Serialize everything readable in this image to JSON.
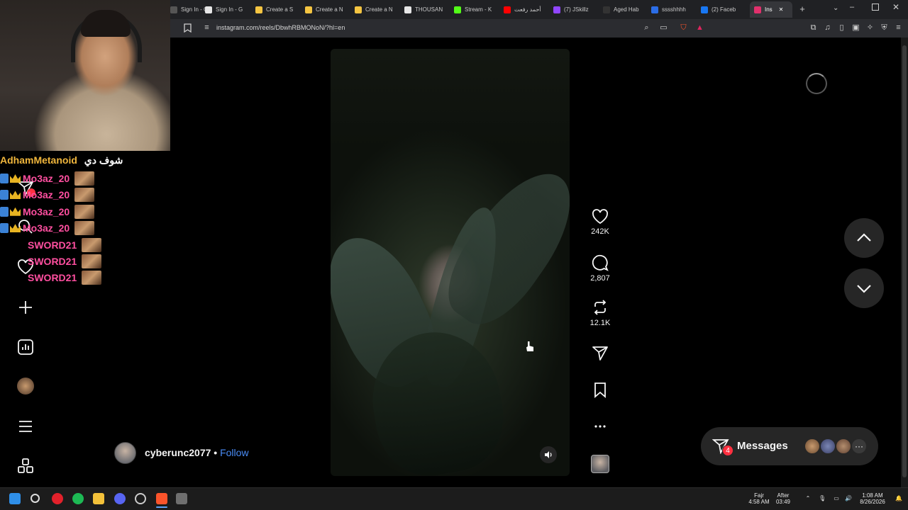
{
  "browser": {
    "tabs": [
      {
        "label": "Sign In - G",
        "color": "#555555"
      },
      {
        "label": "Sign In - G",
        "color": "#e6e6e6"
      },
      {
        "label": "Create a S",
        "color": "#f5c542"
      },
      {
        "label": "Create a N",
        "color": "#f5c542"
      },
      {
        "label": "Create a N",
        "color": "#f5c542"
      },
      {
        "label": "THOUSAN",
        "color": "#e6e6e6"
      },
      {
        "label": "Stream - K",
        "color": "#53fc18"
      },
      {
        "label": "أحمد رفعت",
        "color": "#ff0000"
      },
      {
        "label": "(7) JSkillz",
        "color": "#9146ff"
      },
      {
        "label": "Aged Hab",
        "color": "#333333"
      },
      {
        "label": "sssshhhh",
        "color": "#2b6de6"
      },
      {
        "label": "(2) Faceb",
        "color": "#1877f2"
      },
      {
        "label": "Ins",
        "color": "#e1306c"
      }
    ],
    "new_tab_icon": "plus-icon",
    "url": "instagram.com/reels/DbwhRBMONoN/?hl=en"
  },
  "stream_chat": {
    "header_user": "AdhamMetanoid",
    "header_message": "شوف دي",
    "messages": [
      {
        "user": "Mo3az_20",
        "color": "#ff4fa0",
        "badges": true
      },
      {
        "user": "Mo3az_20",
        "color": "#ff4fa0",
        "badges": true
      },
      {
        "user": "Mo3az_20",
        "color": "#ff4fa0",
        "badges": true
      },
      {
        "user": "Mo3az_20",
        "color": "#ff4fa0",
        "badges": true
      },
      {
        "user": "SWORD21",
        "color": "#ff4fa0",
        "badges": false
      },
      {
        "user": "SWORD21",
        "color": "#ff4fa0",
        "badges": false
      },
      {
        "user": "SWORD21",
        "color": "#ff4fa0",
        "badges": false
      }
    ]
  },
  "reel": {
    "author": "cyberunc2077",
    "separator": "•",
    "follow_label": "Follow",
    "likes": "242K",
    "comments": "2,807",
    "reposts": "12.1K",
    "more_icon": "more-horizontal-icon",
    "audio_icon": "volume-icon"
  },
  "messages_pill": {
    "label": "Messages",
    "unread_count": "4"
  },
  "taskbar": {
    "prayer_name": "Fajr",
    "prayer_time": "4:58 AM",
    "after_label": "After",
    "after_time": "03:49",
    "clock_time": "1:08 AM",
    "clock_date": "8/26/2026"
  },
  "colors": {
    "accent_link": "#4a8df8",
    "badge_red": "#ff3040",
    "chat_header": "#f0b63c"
  }
}
